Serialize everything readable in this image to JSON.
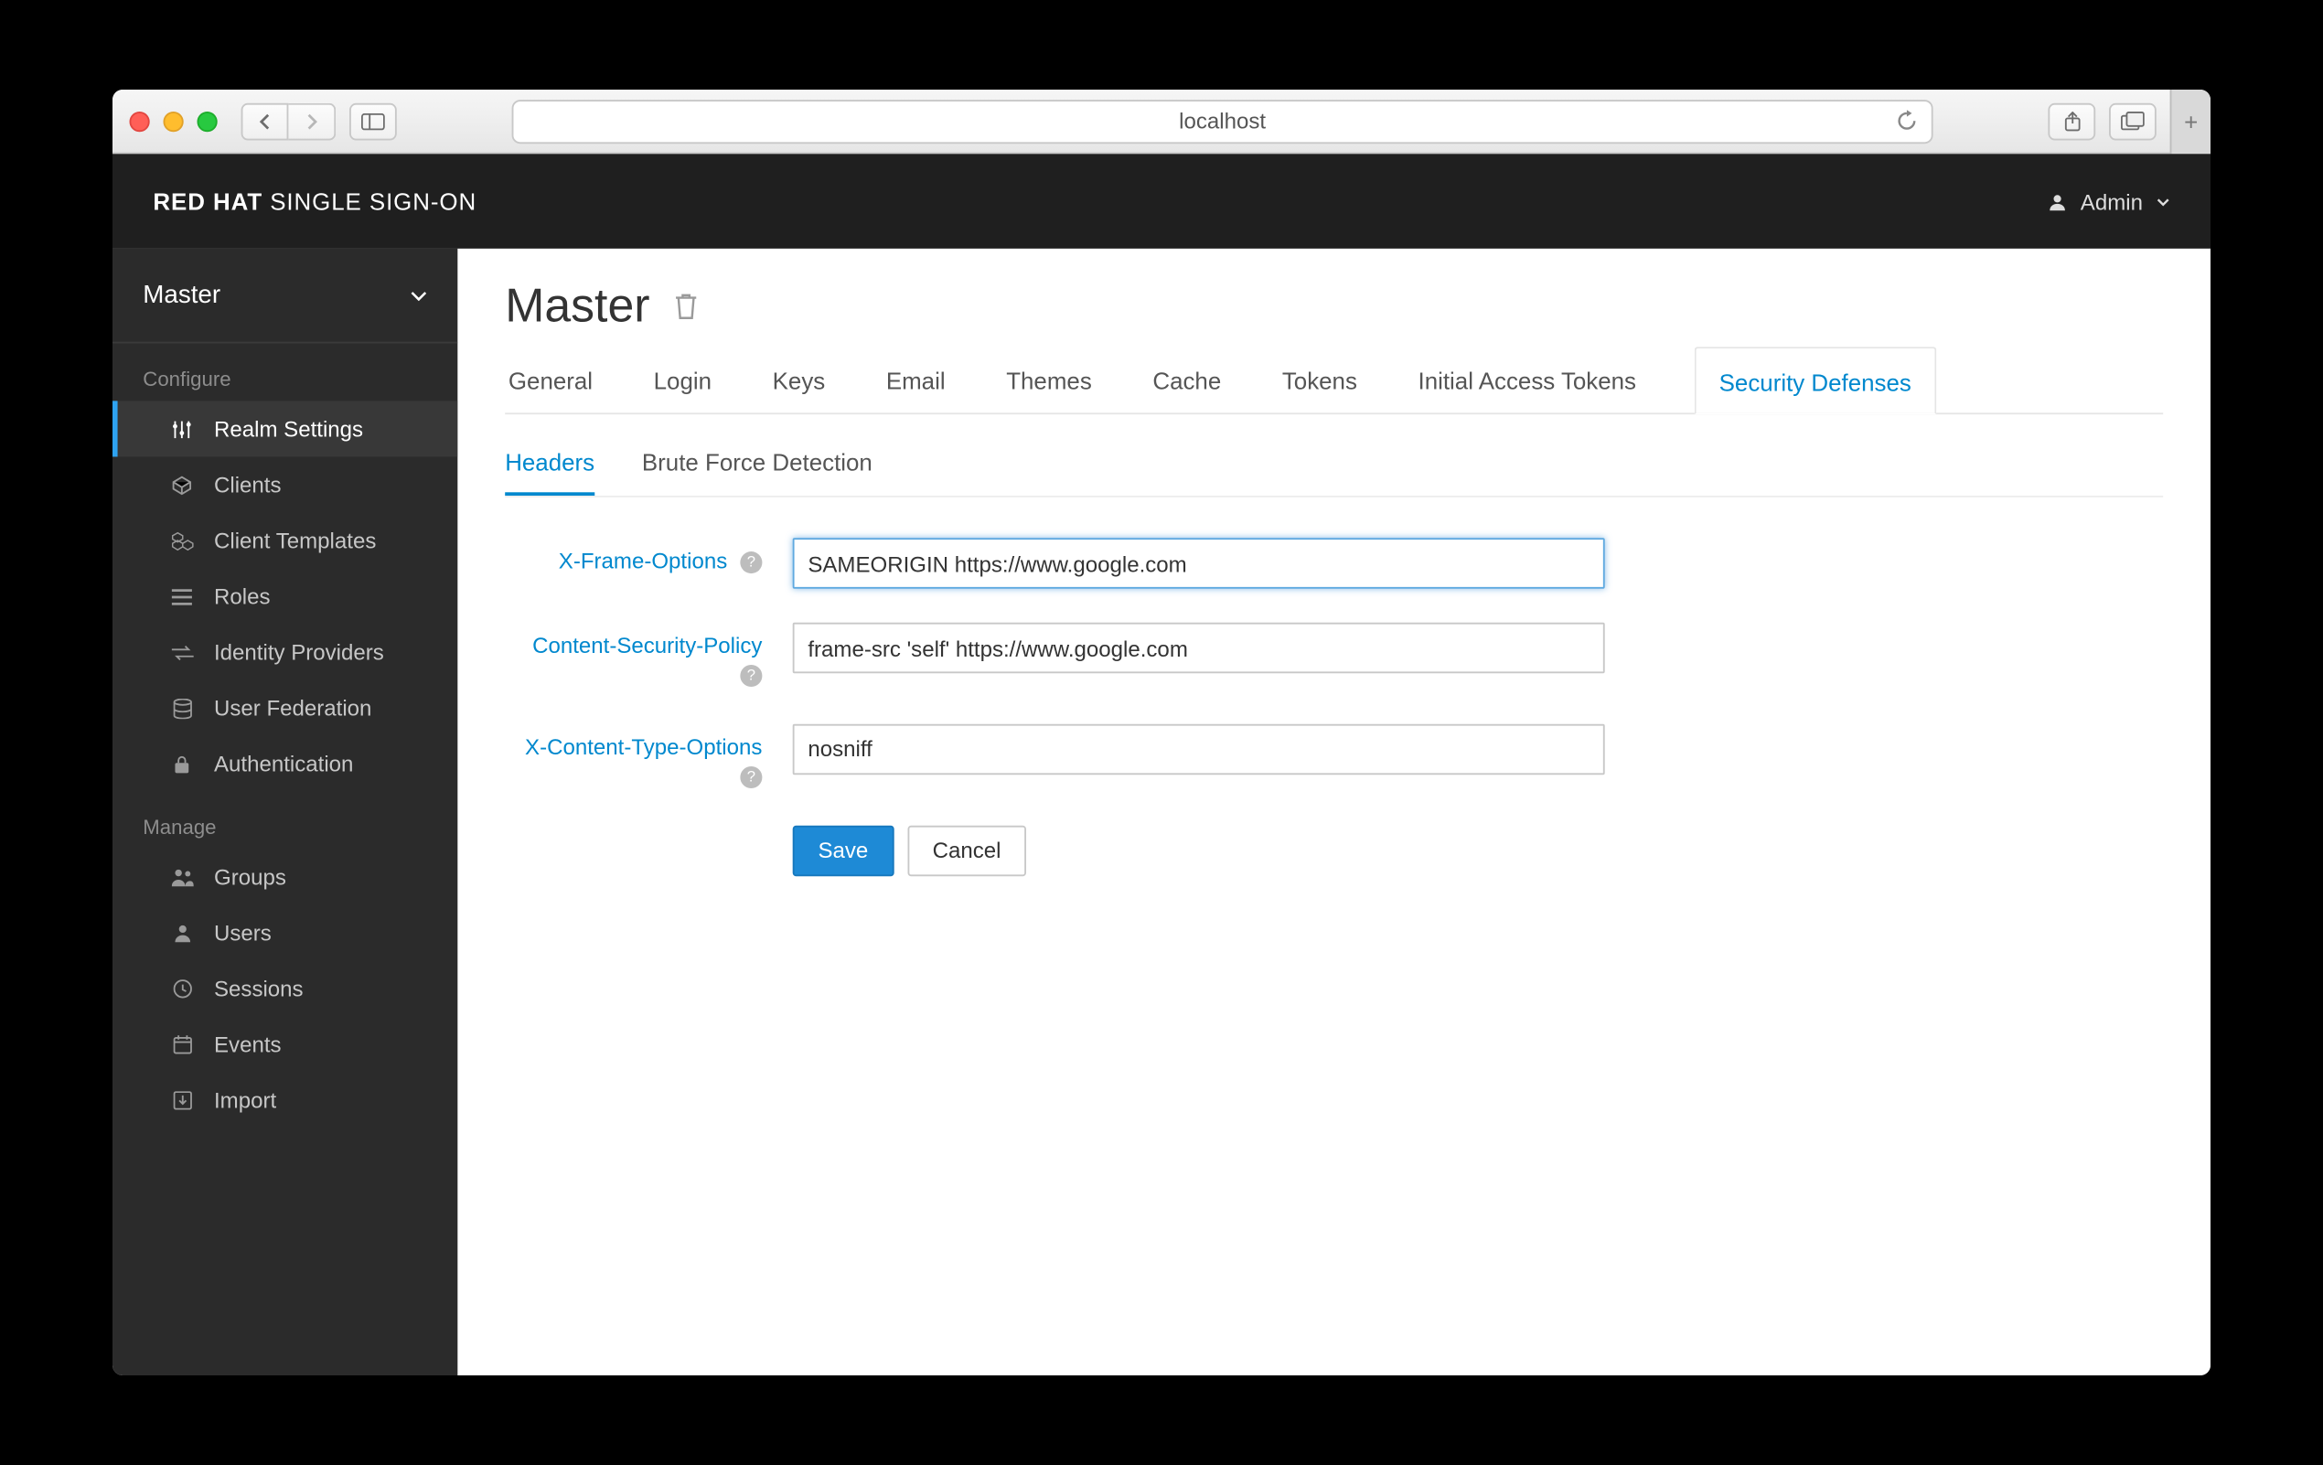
{
  "browser": {
    "address": "localhost"
  },
  "app": {
    "brand_bold": "RED HAT",
    "brand_thin": "SINGLE SIGN-ON",
    "user": "Admin"
  },
  "sidebar": {
    "realm": "Master",
    "sections": {
      "configure": "Configure",
      "manage": "Manage"
    },
    "configure_items": [
      {
        "label": "Realm Settings",
        "active": true
      },
      {
        "label": "Clients"
      },
      {
        "label": "Client Templates"
      },
      {
        "label": "Roles"
      },
      {
        "label": "Identity Providers"
      },
      {
        "label": "User Federation"
      },
      {
        "label": "Authentication"
      }
    ],
    "manage_items": [
      {
        "label": "Groups"
      },
      {
        "label": "Users"
      },
      {
        "label": "Sessions"
      },
      {
        "label": "Events"
      },
      {
        "label": "Import"
      }
    ]
  },
  "page": {
    "title": "Master",
    "tabs": [
      "General",
      "Login",
      "Keys",
      "Email",
      "Themes",
      "Cache",
      "Tokens",
      "Initial Access Tokens",
      "Security Defenses"
    ],
    "active_tab": "Security Defenses",
    "subtabs": [
      "Headers",
      "Brute Force Detection"
    ],
    "active_subtab": "Headers",
    "fields": {
      "xfo": {
        "label": "X-Frame-Options",
        "value": "SAMEORIGIN https://www.google.com"
      },
      "csp": {
        "label": "Content-Security-Policy",
        "value": "frame-src 'self' https://www.google.com"
      },
      "xcto": {
        "label": "X-Content-Type-Options",
        "value": "nosniff"
      }
    },
    "buttons": {
      "save": "Save",
      "cancel": "Cancel"
    }
  }
}
